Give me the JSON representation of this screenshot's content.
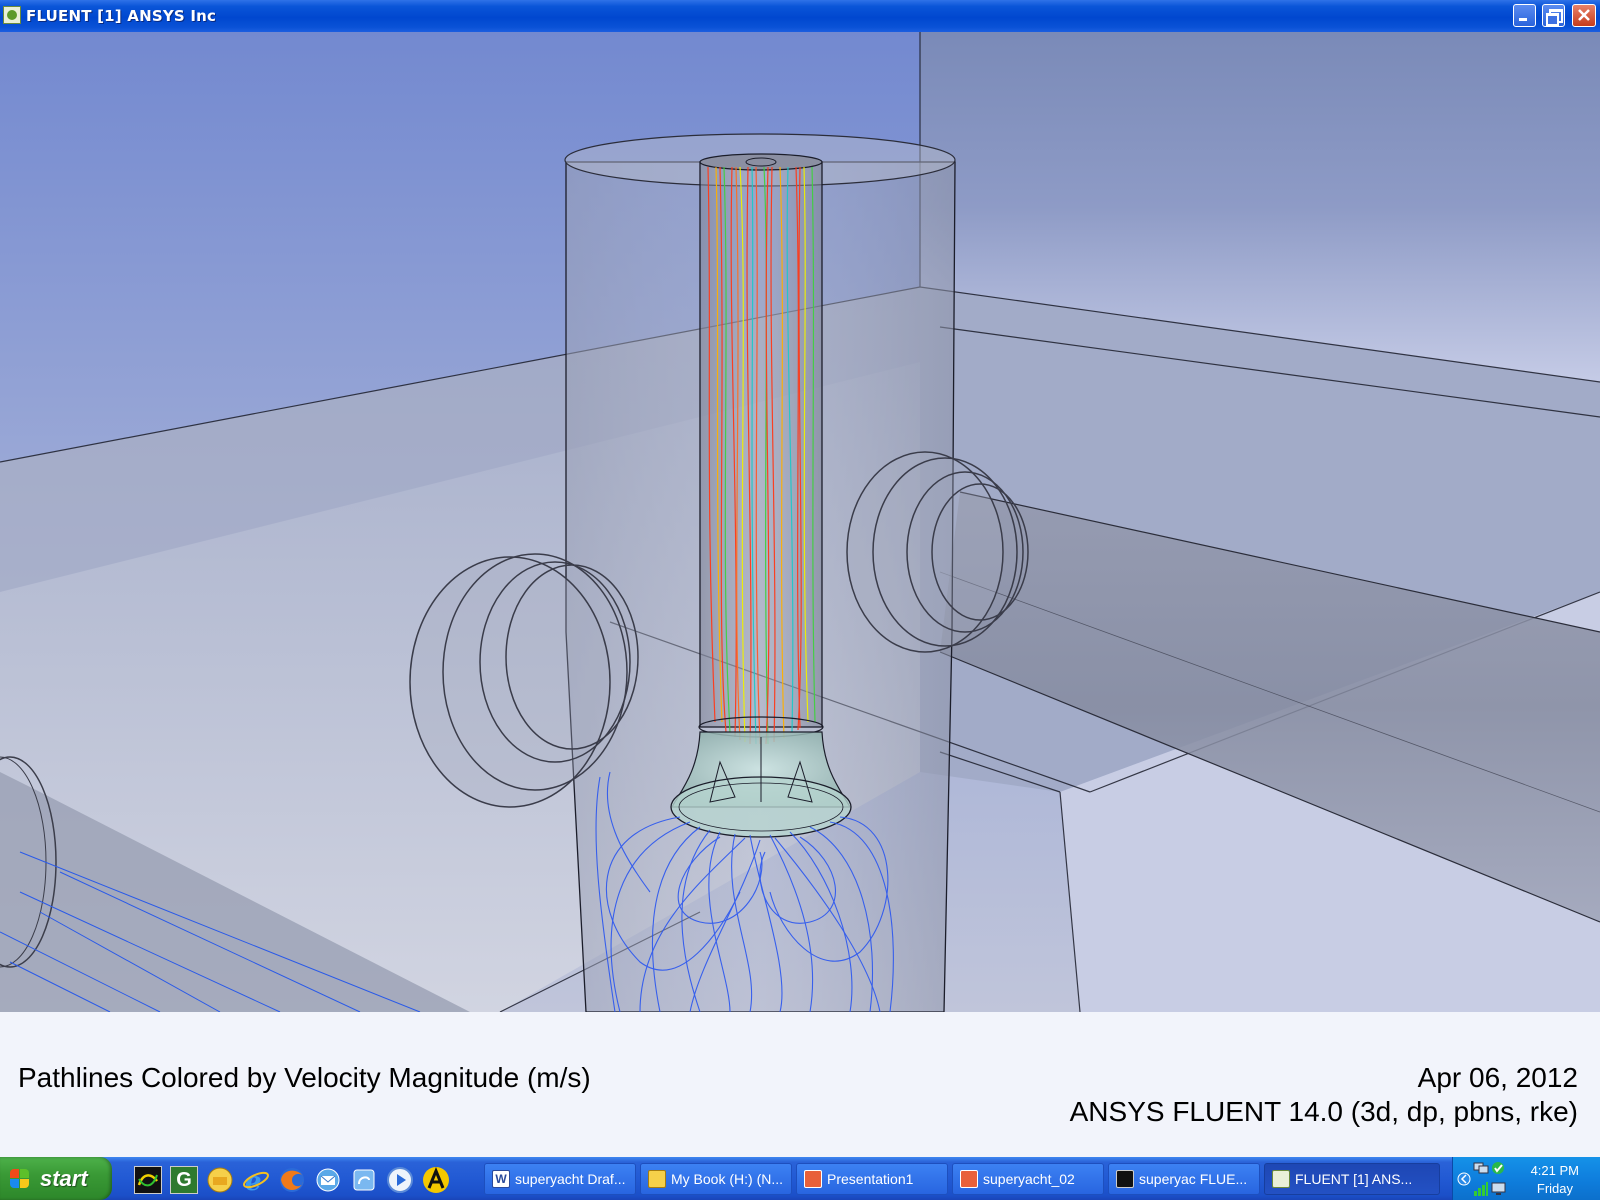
{
  "window": {
    "title": "FLUENT [1] ANSYS Inc",
    "controls": [
      "minimize-icon",
      "maximize-icon",
      "close-icon"
    ]
  },
  "viewport": {
    "background_colors": [
      "#7d95d4",
      "#9aa9d2",
      "#c9cde0"
    ],
    "pathline_colors": [
      "#ff3a1a",
      "#ffb000",
      "#f0f000",
      "#40d040",
      "#20c8c8",
      "#2a56f0"
    ]
  },
  "caption": {
    "left": "Pathlines Colored by Velocity Magnitude (m/s)",
    "date": "Apr 06, 2012",
    "version": "ANSYS FLUENT 14.0 (3d, dp, pbns, rke)"
  },
  "taskbar": {
    "start_label": "start",
    "quick_launch": [
      "fluent-icon",
      "gambit-icon",
      "folder-icon",
      "ie-icon",
      "firefox-icon",
      "mail-icon",
      "sync-icon",
      "media-player-icon",
      "ansys-icon"
    ],
    "buttons": [
      {
        "label": "superyacht Draf...",
        "icon": "word-icon"
      },
      {
        "label": "My Book (H:) (N...",
        "icon": "folder-icon"
      },
      {
        "label": "Presentation1",
        "icon": "powerpoint-icon"
      },
      {
        "label": "superyacht_02",
        "icon": "powerpoint-icon"
      },
      {
        "label": "superyac FLUE...",
        "icon": "fluent-icon"
      },
      {
        "label": "FLUENT [1] ANS...",
        "icon": "fluent-icon"
      }
    ],
    "clock": {
      "time": "4:21 PM",
      "day": "Friday"
    }
  }
}
